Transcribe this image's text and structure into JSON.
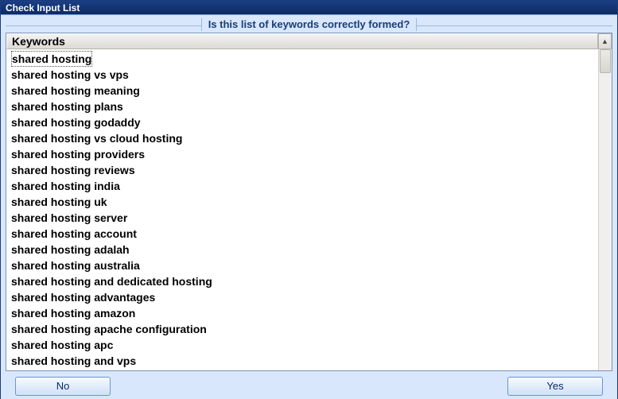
{
  "titlebar": {
    "title": "Check Input List"
  },
  "prompt": "Is this list of keywords correctly formed?",
  "columnHeader": "Keywords",
  "keywords": [
    "shared hosting",
    "shared hosting vs vps",
    "shared hosting meaning",
    "shared hosting plans",
    "shared hosting godaddy",
    "shared hosting vs cloud hosting",
    "shared hosting providers",
    "shared hosting reviews",
    "shared hosting india",
    "shared hosting uk",
    "shared hosting server",
    "shared hosting account",
    "shared hosting adalah",
    "shared hosting australia",
    "shared hosting and dedicated hosting",
    "shared hosting advantages",
    "shared hosting amazon",
    "shared hosting apache configuration",
    "shared hosting apc",
    "shared hosting and vps"
  ],
  "selectedIndex": 0,
  "buttons": {
    "no": "No",
    "yes": "Yes"
  },
  "scrollUpGlyph": "▲"
}
